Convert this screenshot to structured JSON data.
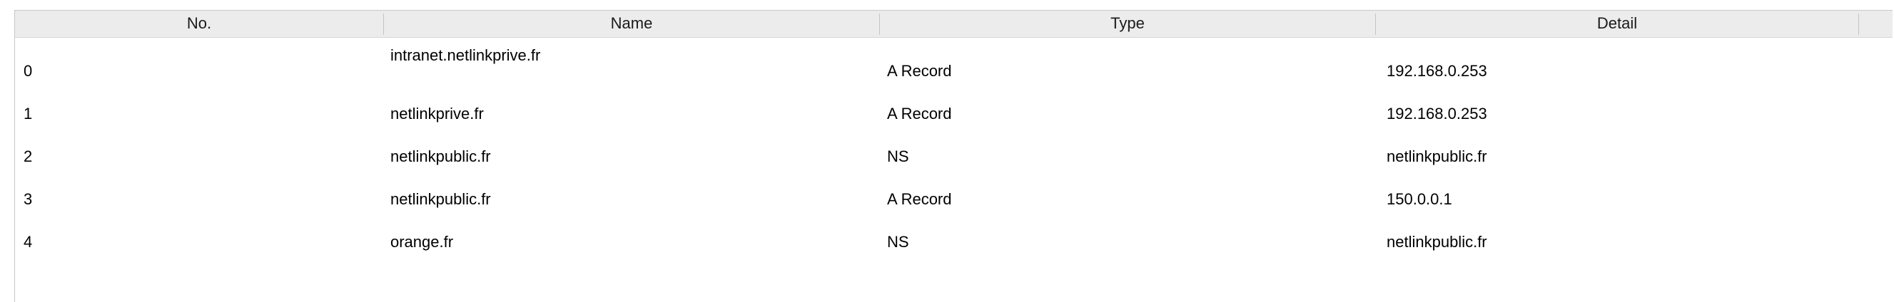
{
  "columns": {
    "no": "No.",
    "name": "Name",
    "type": "Type",
    "detail": "Detail"
  },
  "rows": [
    {
      "no": "0",
      "name": "intranet.netlinkprive.fr",
      "type": "A Record",
      "detail": "192.168.0.253"
    },
    {
      "no": "1",
      "name": "netlinkprive.fr",
      "type": "A Record",
      "detail": "192.168.0.253"
    },
    {
      "no": "2",
      "name": "netlinkpublic.fr",
      "type": "NS",
      "detail": "netlinkpublic.fr"
    },
    {
      "no": "3",
      "name": "netlinkpublic.fr",
      "type": "A Record",
      "detail": "150.0.0.1"
    },
    {
      "no": "4",
      "name": "orange.fr",
      "type": "NS",
      "detail": "netlinkpublic.fr"
    }
  ],
  "colors": {
    "header_background": "#ececec",
    "border": "#c8c8c8",
    "row_background": "#ffffff"
  }
}
